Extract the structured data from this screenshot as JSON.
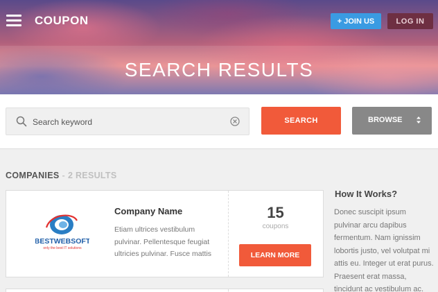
{
  "header": {
    "brand": "COUPON",
    "join_label": "+ JOIN US",
    "login_label": "LOG IN",
    "title": "SEARCH RESULTS",
    "colors": {
      "join": "#3a9be2",
      "login": "#6e2f42"
    }
  },
  "search": {
    "placeholder": "Search keyword",
    "value": "",
    "button_label": "SEARCH",
    "browse_label": "BROWSE",
    "icons": [
      "search-icon",
      "clear-icon",
      "sort-arrows-icon"
    ]
  },
  "results": {
    "section_title": "COMPANIES",
    "separator": "-",
    "count_text": "2 RESULTS",
    "items": [
      {
        "name": "Company Name",
        "description": "Etiam ultrices vestibulum pulvinar. Pellentesque feugiat ultricies pulvinar. Fusce mattis",
        "count": "15",
        "count_label": "coupons",
        "button_label": "LEARN MORE",
        "logo": {
          "name": "BESTWEBSOFT",
          "tagline": "only the best IT solutions"
        }
      }
    ]
  },
  "sidebar": {
    "title": "How It Works?",
    "text": "Donec suscipit ipsum pulvinar arcu dapibus fermentum. Nam ignissim lobortis justo, vel volutpat mi attis eu. Integer ut erat purus. Praesent erat massa, tincidunt ac vestibulum ac."
  },
  "accent_color": "#f15a3a"
}
